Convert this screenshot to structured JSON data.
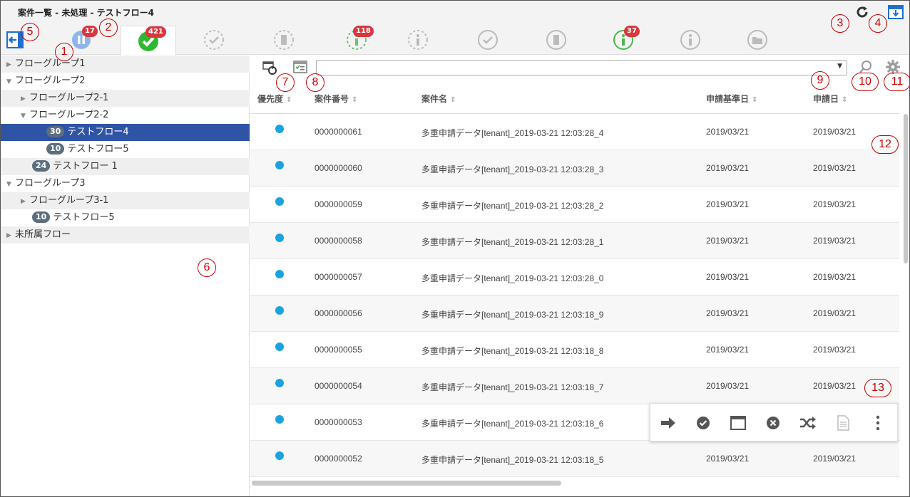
{
  "window": {
    "title": "案件一覧 - 未処理 - テストフロー4"
  },
  "tabs": [
    {
      "icon": "pause-circle-icon",
      "badge": "17"
    },
    {
      "icon": "check-circle-icon",
      "badge": "421",
      "active": true
    },
    {
      "icon": "check-dashed-icon"
    },
    {
      "icon": "document-dashed-icon"
    },
    {
      "icon": "info-dashed-green-icon",
      "badge": "118"
    },
    {
      "icon": "info-dashed-icon"
    },
    {
      "icon": "check-outline-icon"
    },
    {
      "icon": "document-outline-icon"
    },
    {
      "icon": "info-green-icon",
      "badge": "37"
    },
    {
      "icon": "info-outline-icon"
    },
    {
      "icon": "folder-outline-icon"
    }
  ],
  "callouts": [
    "1",
    "2",
    "3",
    "4",
    "5",
    "6",
    "7",
    "8",
    "9",
    "10",
    "11",
    "12",
    "13"
  ],
  "sidebar": {
    "items": [
      {
        "label": "フローグループ1",
        "caret": "▶",
        "count": ""
      },
      {
        "label": "フローグループ2",
        "caret": "▼",
        "count": ""
      },
      {
        "label": "フローグループ2-1",
        "caret": "▶",
        "count": ""
      },
      {
        "label": "フローグループ2-2",
        "caret": "▼",
        "count": ""
      },
      {
        "label": "テストフロー4",
        "caret": "",
        "count": "30",
        "selected": true
      },
      {
        "label": "テストフロー5",
        "caret": "",
        "count": "10"
      },
      {
        "label": "テストフロー 1",
        "caret": "",
        "count": "24"
      },
      {
        "label": "フローグループ3",
        "caret": "▼",
        "count": ""
      },
      {
        "label": "フローグループ3-1",
        "caret": "▶",
        "count": ""
      },
      {
        "label": "テストフロー5",
        "caret": "",
        "count": "10"
      },
      {
        "label": "未所属フロー",
        "caret": "▶",
        "count": ""
      }
    ]
  },
  "search": {
    "value": "",
    "dropdown_arrow": "▼"
  },
  "table": {
    "columns": [
      "優先度",
      "案件番号",
      "案件名",
      "申請基準日",
      "申請日"
    ],
    "sort_glyph": "⇕",
    "rows": [
      {
        "number": "0000000061",
        "name": "多重申請データ[tenant]_2019-03-21 12:03:28_4",
        "base_date": "2019/03/21",
        "apply_date": "2019/03/21"
      },
      {
        "number": "0000000060",
        "name": "多重申請データ[tenant]_2019-03-21 12:03:28_3",
        "base_date": "2019/03/21",
        "apply_date": "2019/03/21"
      },
      {
        "number": "0000000059",
        "name": "多重申請データ[tenant]_2019-03-21 12:03:28_2",
        "base_date": "2019/03/21",
        "apply_date": "2019/03/21"
      },
      {
        "number": "0000000058",
        "name": "多重申請データ[tenant]_2019-03-21 12:03:28_1",
        "base_date": "2019/03/21",
        "apply_date": "2019/03/21"
      },
      {
        "number": "0000000057",
        "name": "多重申請データ[tenant]_2019-03-21 12:03:28_0",
        "base_date": "2019/03/21",
        "apply_date": "2019/03/21"
      },
      {
        "number": "0000000056",
        "name": "多重申請データ[tenant]_2019-03-21 12:03:18_9",
        "base_date": "2019/03/21",
        "apply_date": "2019/03/21"
      },
      {
        "number": "0000000055",
        "name": "多重申請データ[tenant]_2019-03-21 12:03:18_8",
        "base_date": "2019/03/21",
        "apply_date": "2019/03/21"
      },
      {
        "number": "0000000054",
        "name": "多重申請データ[tenant]_2019-03-21 12:03:18_7",
        "base_date": "2019/03/21",
        "apply_date": "2019/03/21"
      },
      {
        "number": "0000000053",
        "name": "多重申請データ[tenant]_2019-03-21 12:03:18_6",
        "base_date": "",
        "apply_date": ""
      },
      {
        "number": "0000000052",
        "name": "多重申請データ[tenant]_2019-03-21 12:03:18_5",
        "base_date": "2019/03/21",
        "apply_date": "2019/03/21"
      }
    ]
  },
  "action_bar": [
    "arrow-right-icon",
    "check-icon",
    "window-icon",
    "close-circle-icon",
    "shuffle-icon",
    "document-icon",
    "more-vertical-icon"
  ],
  "colors": {
    "selected": "#2f54a5",
    "badge": "#d9363e",
    "priority_dot": "#1aa3e0",
    "active_check": "#2eb82e"
  }
}
